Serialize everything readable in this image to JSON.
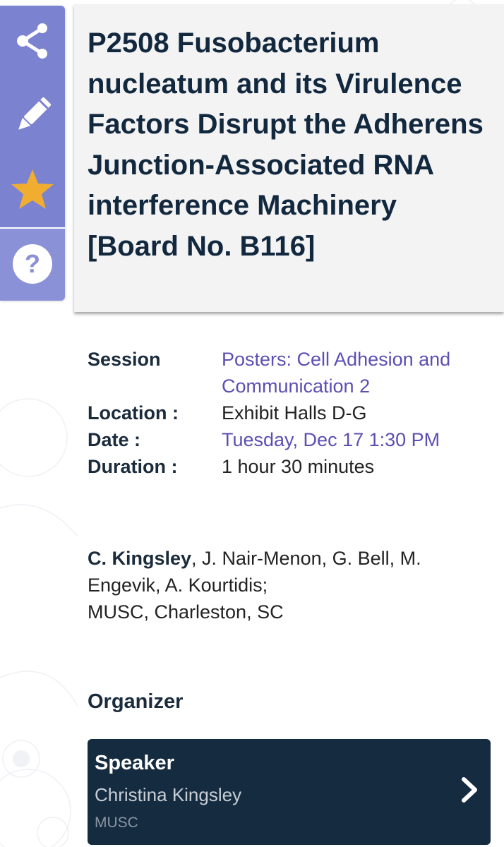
{
  "title": "P2508 Fusobacterium nucleatum and its Virulence Factors Disrupt the Adherens Junction-Associated RNA interference Machinery [Board No. B116]",
  "sidebar": {
    "share_icon": "share-icon",
    "edit_icon": "pencil-icon",
    "favorite_icon": "star-icon",
    "help_icon": "question-icon"
  },
  "details": {
    "session_label": "Session",
    "session_value_line1": "Posters: Cell Adhesion and",
    "session_value_line2": "Communication 2",
    "location_label": "Location :",
    "location_value": "Exhibit Halls D-G",
    "date_label": "Date :",
    "date_value": "Tuesday, Dec 17 1:30 PM",
    "duration_label": "Duration :",
    "duration_value": "1 hour 30 minutes"
  },
  "authors": {
    "presenter": "C. Kingsley",
    "others_line1": ", J. Nair-Menon, G. Bell, M.",
    "others_line2": "Engevik, A. Kourtidis;",
    "affiliation": "MUSC, Charleston, SC"
  },
  "organizer": {
    "heading": "Organizer",
    "role": "Speaker",
    "name": "Christina Kingsley",
    "org": "MUSC"
  },
  "colors": {
    "sidebar": "#7b82cf",
    "link": "#5a4fb3",
    "star": "#f0ad30",
    "card_dark": "#142b40",
    "title_text": "#12283e"
  }
}
